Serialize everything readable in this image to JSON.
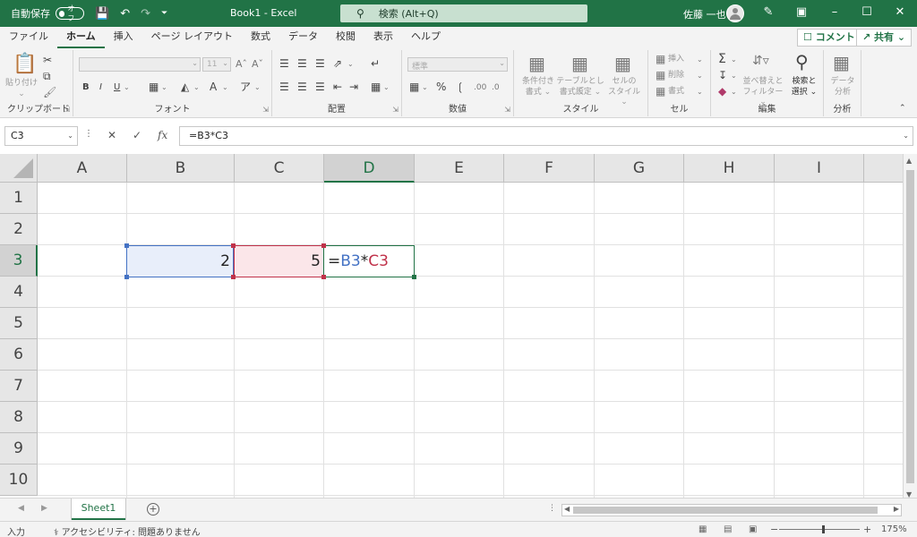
{
  "titlebar": {
    "autosave_label": "自動保存",
    "autosave_state": "オフ",
    "title": "Book1  -  Excel",
    "search_placeholder": "検索 (Alt+Q)",
    "user": "佐藤 一也"
  },
  "tabs": [
    "ファイル",
    "ホーム",
    "挿入",
    "ページ レイアウト",
    "数式",
    "データ",
    "校閲",
    "表示",
    "ヘルプ"
  ],
  "active_tab": "ホーム",
  "tab_actions": {
    "comment": "コメント",
    "share": "共有"
  },
  "ribbon": {
    "clipboard": {
      "label": "クリップボード",
      "paste": "貼り付け"
    },
    "font": {
      "label": "フォント",
      "size": "11"
    },
    "alignment": {
      "label": "配置"
    },
    "number": {
      "label": "数値",
      "format": "標準"
    },
    "styles": {
      "label": "スタイル",
      "conditional_line1": "条件付き",
      "conditional_line2": "書式 ⌄",
      "table_line1": "テーブルとして",
      "table_line2": "書式設定 ⌄",
      "cell_line1": "セルの",
      "cell_line2": "スタイル ⌄"
    },
    "cells": {
      "label": "セル",
      "insert": "挿入",
      "delete": "削除",
      "format": "書式"
    },
    "editing": {
      "label": "編集",
      "sort_line1": "並べ替えと",
      "sort_line2": "フィルター ⌄",
      "find_line1": "検索と",
      "find_line2": "選択 ⌄"
    },
    "analysis": {
      "label": "分析",
      "data_line1": "データ",
      "data_line2": "分析"
    }
  },
  "formula_bar": {
    "name_box": "C3",
    "formula": "=B3*C3"
  },
  "grid": {
    "columns": [
      "A",
      "B",
      "C",
      "D",
      "E",
      "F",
      "G",
      "H",
      "I"
    ],
    "selected_column": "D",
    "rows": [
      "1",
      "2",
      "3",
      "4",
      "5",
      "6",
      "7",
      "8",
      "9",
      "10"
    ],
    "selected_row": "3",
    "cells": {
      "B3": "2",
      "C3": "5",
      "D3_eq": "=",
      "D3_ref1": "B3",
      "D3_op": "*",
      "D3_ref2": "C3"
    }
  },
  "sheets": [
    "Sheet1"
  ],
  "status": {
    "mode": "入力",
    "accessibility": "アクセシビリティ: 問題ありません",
    "zoom": "175%"
  },
  "colors": {
    "brand": "#217346",
    "ref_blue": "#4472c4",
    "ref_red": "#c0324a"
  }
}
